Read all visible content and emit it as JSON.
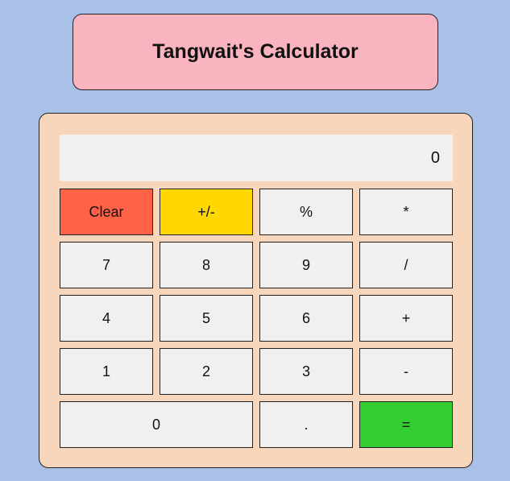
{
  "title": "Tangwait's Calculator",
  "display": {
    "value": "0"
  },
  "keys": {
    "clear": "Clear",
    "plus_minus": "+/-",
    "percent": "%",
    "multiply": "*",
    "seven": "7",
    "eight": "8",
    "nine": "9",
    "divide": "/",
    "four": "4",
    "five": "5",
    "six": "6",
    "add": "+",
    "one": "1",
    "two": "2",
    "three": "3",
    "subtract": "-",
    "zero": "0",
    "decimal": ".",
    "equals": "="
  },
  "colors": {
    "background": "#a9c1e6",
    "title_box": "#f9b4c0",
    "calculator_body": "#f8d6bb",
    "clear_key": "#fe6347",
    "sign_key": "#ffd701",
    "equals_key": "#33cd32",
    "default_key": "#f0f0f0"
  }
}
